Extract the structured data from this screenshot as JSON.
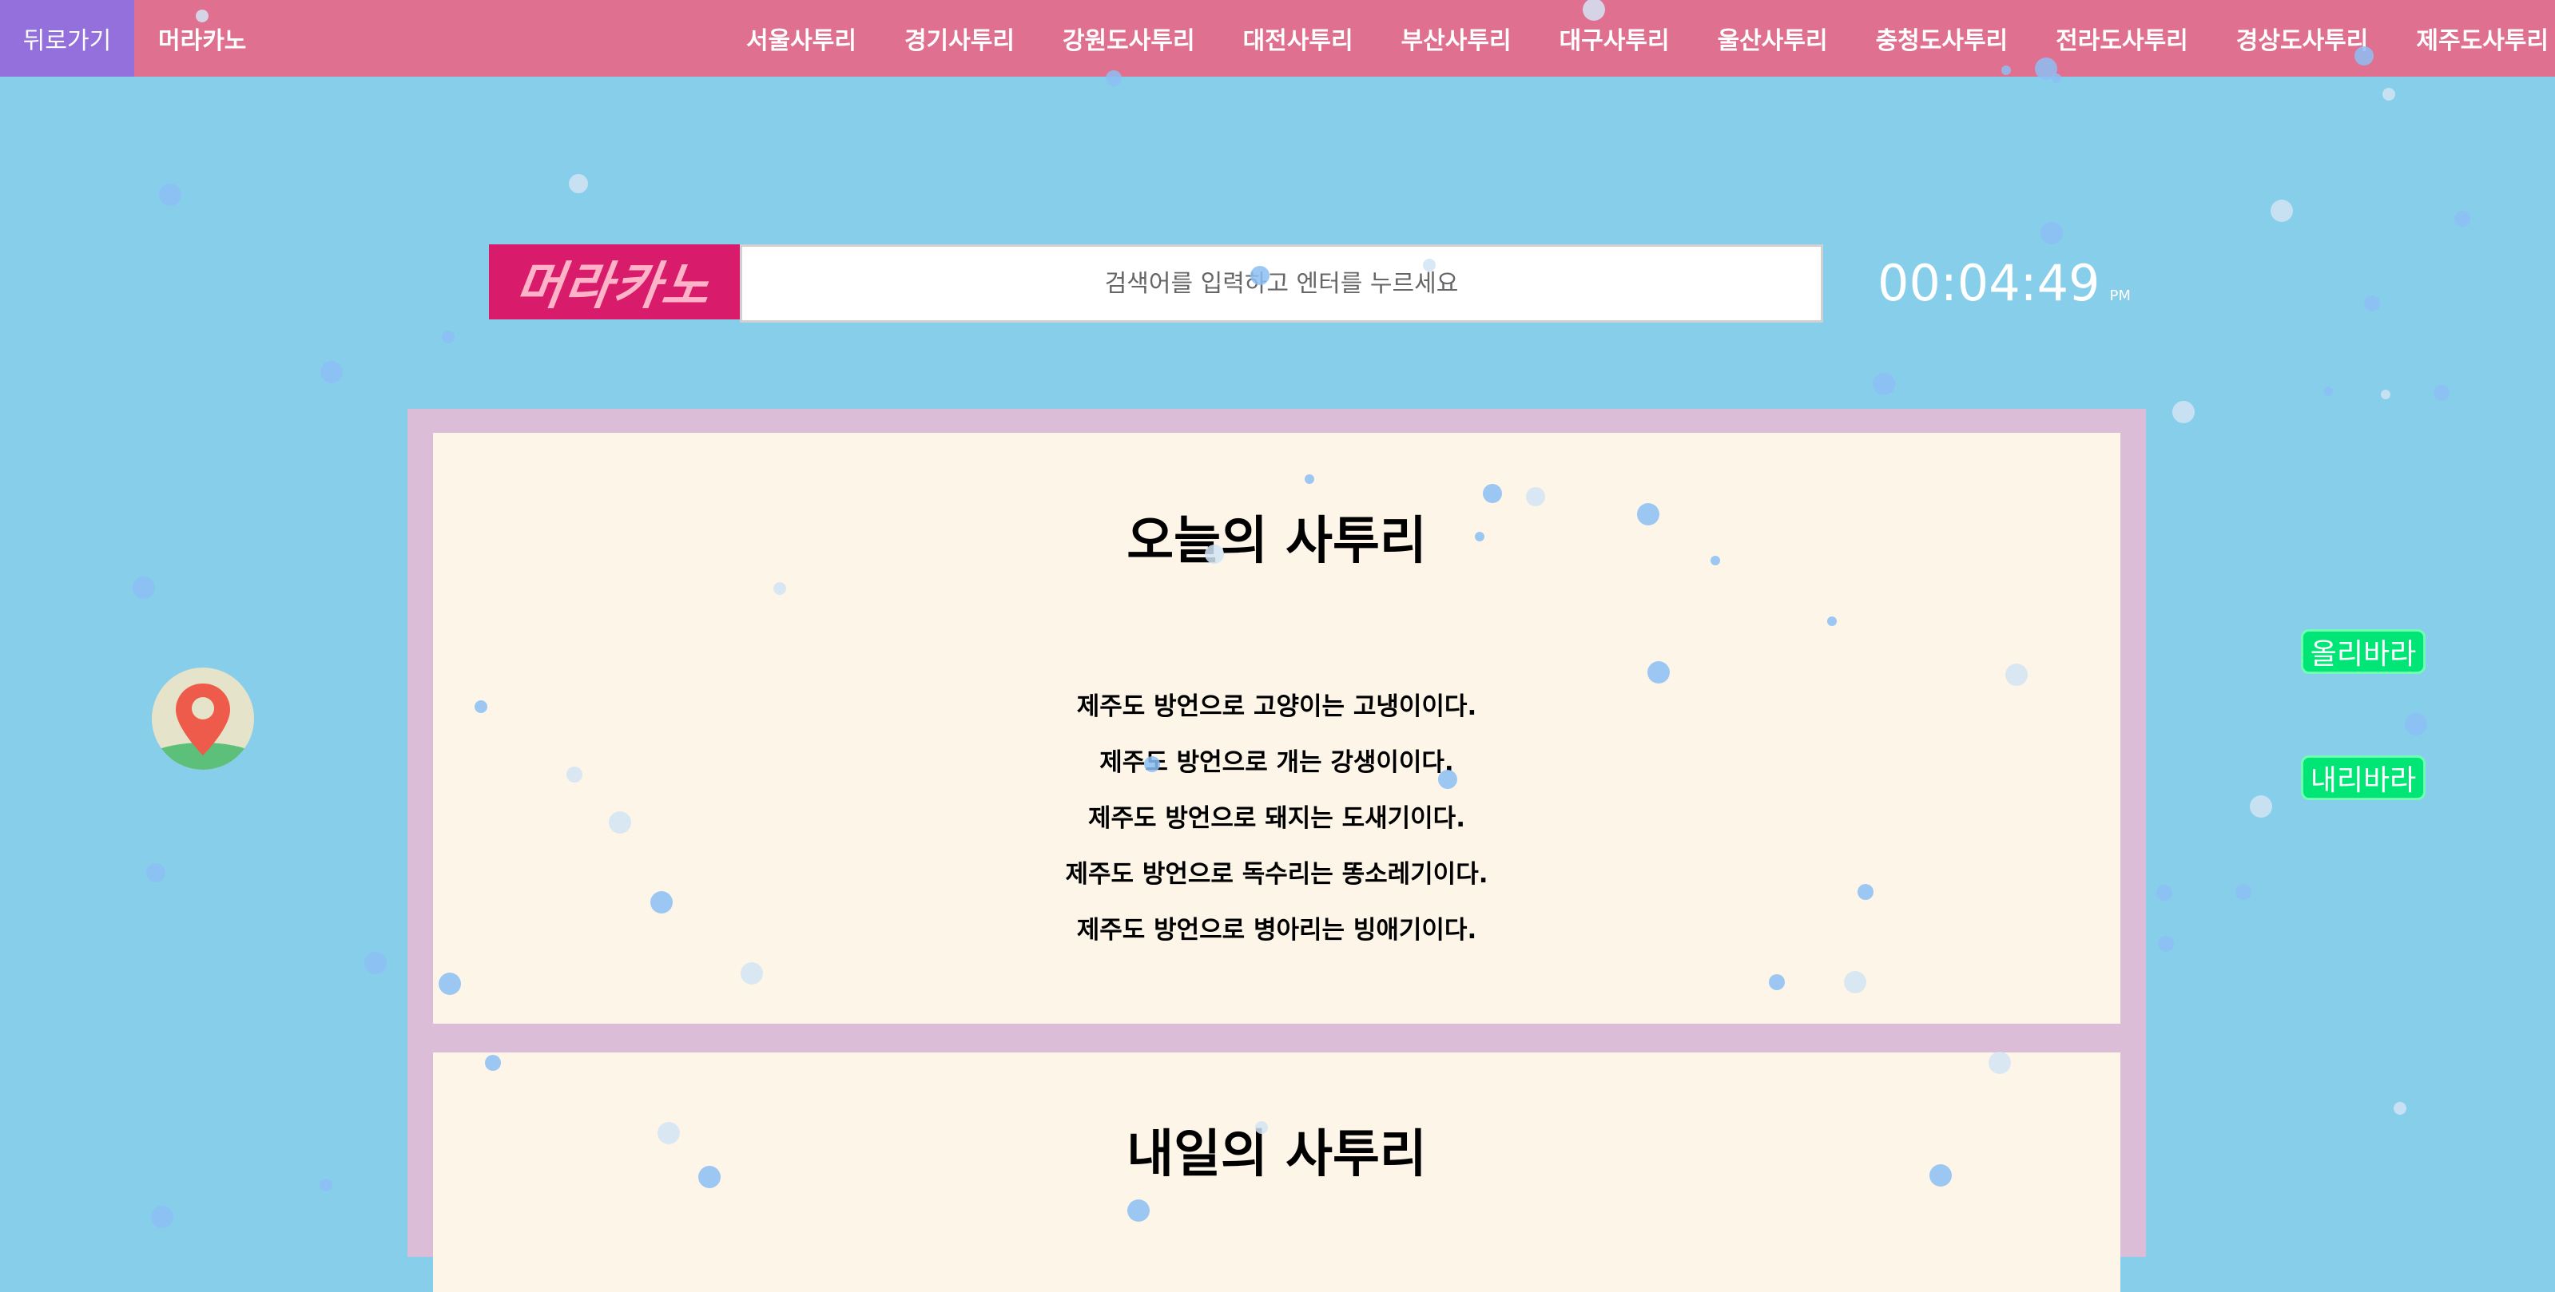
{
  "nav": {
    "back_label": "뒤로가기",
    "brand_label": "머라카노",
    "regions": [
      "서울사투리",
      "경기사투리",
      "강원도사투리",
      "대전사투리",
      "부산사투리",
      "대구사투리",
      "울산사투리",
      "충청도사투리",
      "전라도사투리",
      "경상도사투리",
      "제주도사투리"
    ]
  },
  "logo": {
    "text": "머라카노"
  },
  "search": {
    "placeholder": "검색어를 입력하고 엔터를 누르세요"
  },
  "clock": {
    "time": "00:04:49",
    "ampm": "PM"
  },
  "today": {
    "title": "오늘의 사투리",
    "phrases": [
      "제주도 방언으로 고양이는 고냉이이다.",
      "제주도 방언으로 개는 강생이이다.",
      "제주도 방언으로 돼지는 도새기이다.",
      "제주도 방언으로 독수리는 똥소레기이다.",
      "제주도 방언으로 병아리는 빙애기이다."
    ]
  },
  "tomorrow": {
    "title": "내일의 사투리"
  },
  "side": {
    "up_label": "올리바라",
    "down_label": "내리바라"
  },
  "icons": {
    "map": "map-pin-icon"
  },
  "colors": {
    "background": "#87ceeb",
    "nav_bar": "#e07090",
    "back_button": "#9370db",
    "logo_bg": "#d81b6a",
    "panel_border": "#dbbdd8",
    "card_bg": "#fdf5e8",
    "side_button": "#00e676"
  }
}
